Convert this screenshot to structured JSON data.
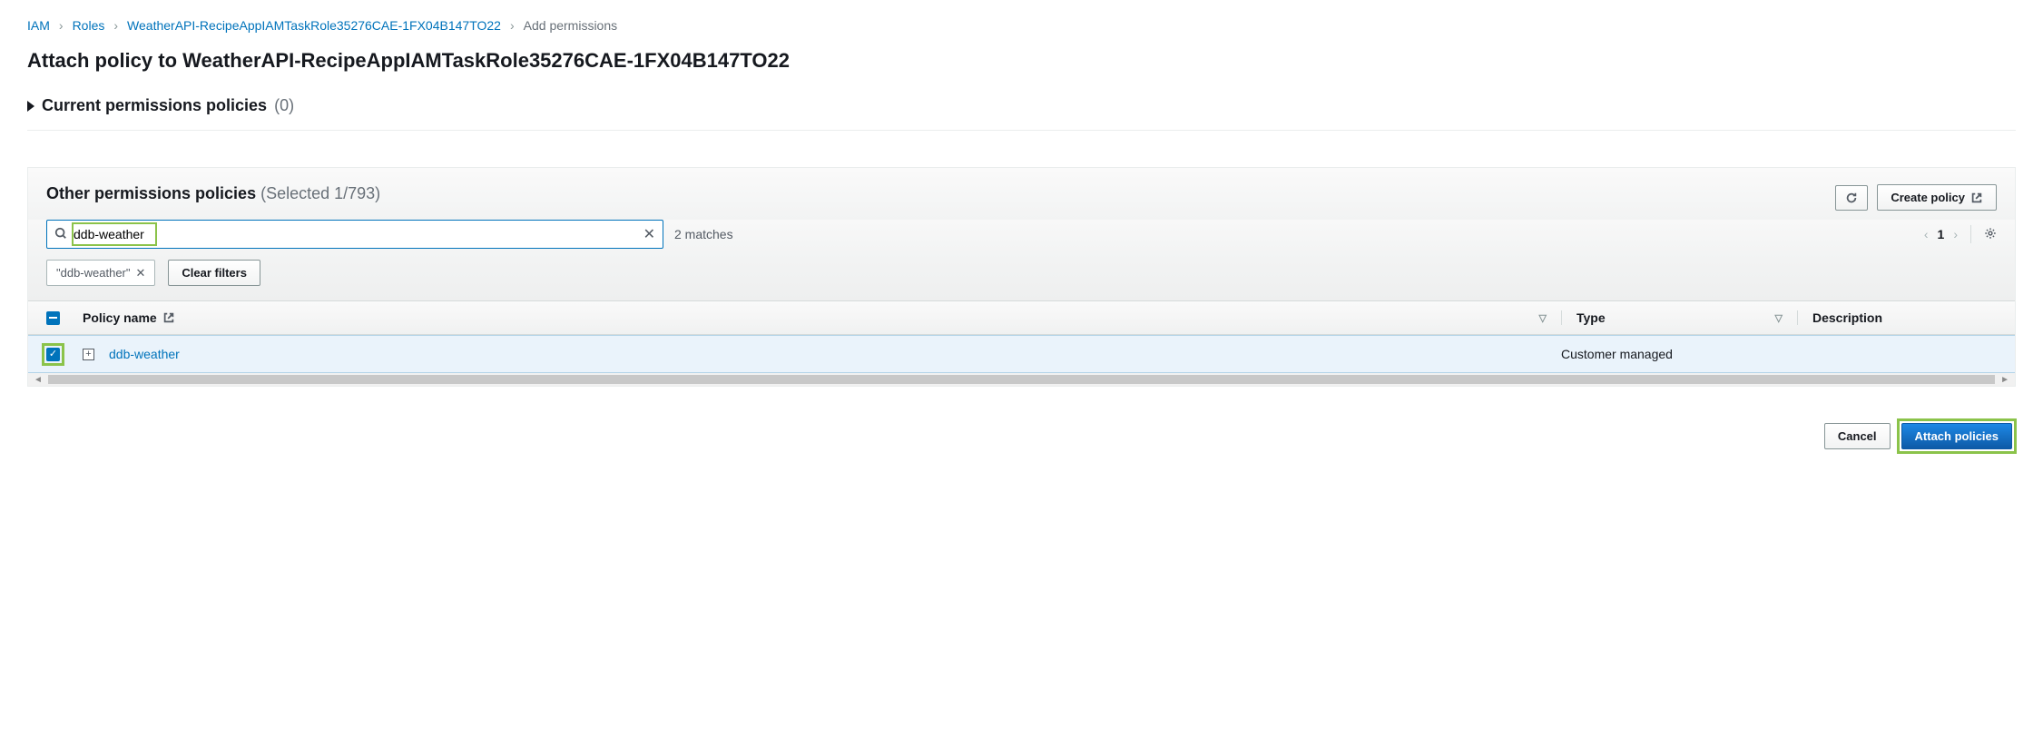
{
  "breadcrumb": {
    "items": [
      "IAM",
      "Roles",
      "WeatherAPI-RecipeAppIAMTaskRole35276CAE-1FX04B147TO22"
    ],
    "current": "Add permissions"
  },
  "page_title": "Attach policy to WeatherAPI-RecipeAppIAMTaskRole35276CAE-1FX04B147TO22",
  "current_policies": {
    "label": "Current permissions policies",
    "count": "(0)"
  },
  "other_policies": {
    "label": "Other permissions policies",
    "selected": "(Selected 1/793)",
    "create_button": "Create policy"
  },
  "search": {
    "value": "ddb-weather",
    "matches": "2 matches"
  },
  "filter_chip": {
    "label": "\"ddb-weather\""
  },
  "clear_filters": "Clear filters",
  "pager": {
    "page": "1"
  },
  "table": {
    "headers": {
      "name": "Policy name",
      "type": "Type",
      "desc": "Description"
    },
    "rows": [
      {
        "name": "ddb-weather",
        "type": "Customer managed",
        "desc": ""
      }
    ]
  },
  "footer": {
    "cancel": "Cancel",
    "attach": "Attach policies"
  }
}
